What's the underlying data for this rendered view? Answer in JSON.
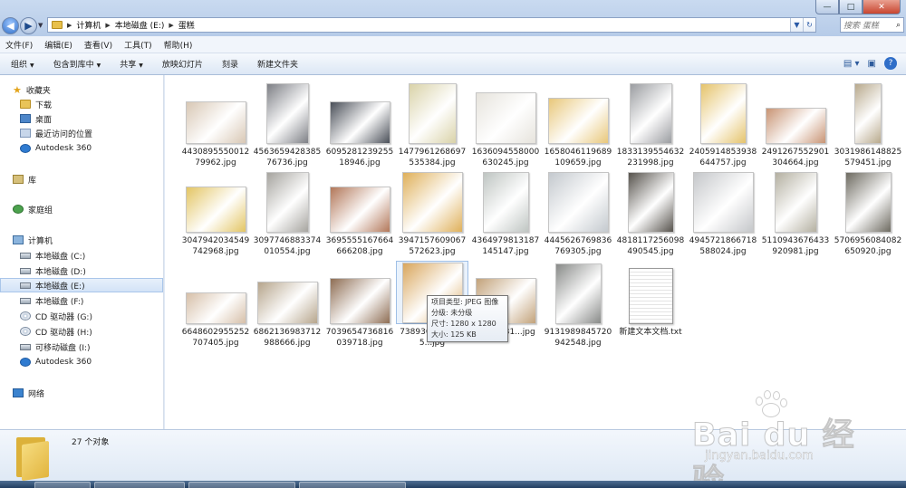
{
  "window": {
    "minimize": "—",
    "maximize": "□",
    "close": "✕"
  },
  "address": {
    "crumbs": [
      "计算机",
      "本地磁盘 (E:)",
      "蛋糕"
    ],
    "search_placeholder": "搜索 蛋糕"
  },
  "menu": [
    "文件(F)",
    "编辑(E)",
    "查看(V)",
    "工具(T)",
    "帮助(H)"
  ],
  "toolbar": {
    "organize": "组织",
    "include_library": "包含到库中",
    "share": "共享",
    "slideshow": "放映幻灯片",
    "burn": "刻录",
    "new_folder": "新建文件夹"
  },
  "sidebar": {
    "favorites": "收藏夹",
    "downloads": "下载",
    "desktop": "桌面",
    "recent": "最近访问的位置",
    "autodesk1": "Autodesk 360",
    "libraries": "库",
    "homegroup": "家庭组",
    "computer": "计算机",
    "drive_c": "本地磁盘 (C:)",
    "drive_d": "本地磁盘 (D:)",
    "drive_e": "本地磁盘 (E:)",
    "drive_f": "本地磁盘 (F:)",
    "cd_g": "CD 驱动器 (G:)",
    "cd_h": "CD 驱动器 (H:)",
    "removable_i": "可移动磁盘 (I:)",
    "autodesk2": "Autodesk 360",
    "network": "网络"
  },
  "files": [
    {
      "name": "443089555001279962.jpg",
      "color": "#d8c7b4"
    },
    {
      "name": "456365942838576736.jpg",
      "color": "#7d7f85"
    },
    {
      "name": "609528123925518946.jpg",
      "color": "#4a4f58"
    },
    {
      "name": "1477961268697535384.jpg",
      "color": "#d9d2a8"
    },
    {
      "name": "1636094558000630245.jpg",
      "color": "#e6e3dc"
    },
    {
      "name": "1658046119689109659.jpg",
      "color": "#e8c77a"
    },
    {
      "name": "1833139554632231998.jpg",
      "color": "#9b9da1"
    },
    {
      "name": "2405914853938644757.jpg",
      "color": "#e5c36b"
    },
    {
      "name": "2491267552901304664.jpg",
      "color": "#c89474"
    },
    {
      "name": "3031986148825579451.jpg",
      "color": "#b8a98c"
    },
    {
      "name": "3047942034549742968.jpg",
      "color": "#e3c563"
    },
    {
      "name": "3097746883374010554.jpg",
      "color": "#a6a49f"
    },
    {
      "name": "3695555167664666208.jpg",
      "color": "#b27759"
    },
    {
      "name": "3947157609067572623.jpg",
      "color": "#dfb05a"
    },
    {
      "name": "4364979813187145147.jpg",
      "color": "#bfc5c2"
    },
    {
      "name": "4445626769836769305.jpg",
      "color": "#c4c9ce"
    },
    {
      "name": "4818117256098490545.jpg",
      "color": "#56524c"
    },
    {
      "name": "4945721866718588024.jpg",
      "color": "#c5c7ca"
    },
    {
      "name": "5110943676433920981.jpg",
      "color": "#b4b0a1"
    },
    {
      "name": "5706956084082650920.jpg",
      "color": "#6d6a60"
    },
    {
      "name": "6648602955252707405.jpg",
      "color": "#d6bfa8"
    },
    {
      "name": "6862136983712988666.jpg",
      "color": "#b6a58c"
    },
    {
      "name": "7039654736816039718.jpg",
      "color": "#8e6d53"
    },
    {
      "name": "7389305...23005...jpg",
      "color": "#d9a65c"
    },
    {
      "name": "...122531...jpg",
      "color": "#c2a27a"
    },
    {
      "name": "9131989845720942548.jpg",
      "color": "#888a88"
    },
    {
      "name": "新建文本文档.txt",
      "color": "#ffffff"
    }
  ],
  "tooltip": {
    "type": "项目类型: JPEG 图像",
    "rating": "分级: 未分级",
    "size": "尺寸: 1280 x 1280",
    "filesize": "大小: 125 KB"
  },
  "status": {
    "count": "27 个对象"
  },
  "watermark": {
    "main": "Bai du 经验",
    "sub": "jingyan.baidu.com"
  }
}
